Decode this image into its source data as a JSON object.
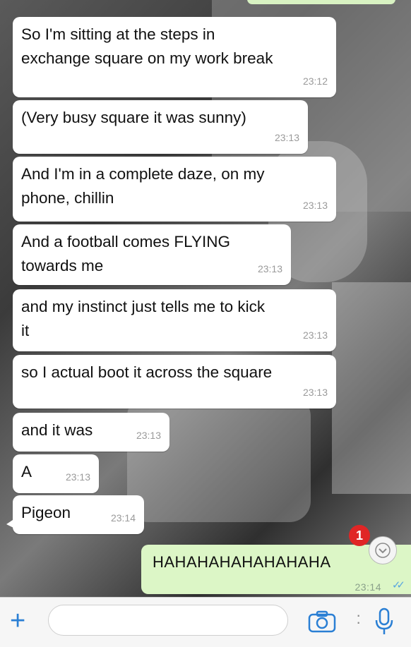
{
  "messages": [
    {
      "text": "So I'm sitting at the steps in\nexchange square on my work break",
      "time": "23:12"
    },
    {
      "text": "(Very busy square it was sunny)",
      "time": "23:13"
    },
    {
      "text": "And I'm in a complete daze, on my\nphone, chillin",
      "time": "23:13"
    },
    {
      "text": "And a football comes FLYING\ntowards me",
      "time": "23:13"
    },
    {
      "text": "and my instinct just tells me to kick\nit",
      "time": "23:13"
    },
    {
      "text": "so I actual boot it across the square",
      "time": "23:13"
    },
    {
      "text": "and it was",
      "time": "23:13"
    },
    {
      "text": "A",
      "time": "23:13"
    },
    {
      "text": "Pigeon",
      "time": "23:14"
    }
  ],
  "outgoing": {
    "text": "HAHAHAHAHAHAHAHA",
    "time": "23:14"
  },
  "unread_count": "1",
  "icons": {
    "plus": "plus-icon",
    "camera": "camera-icon",
    "mic": "microphone-icon",
    "scroll": "chevron-down-icon",
    "ticks": "double-check-icon"
  },
  "colors": {
    "incoming_bubble": "#ffffff",
    "outgoing_bubble": "#dcf6c6",
    "accent": "#2a7fd4",
    "badge": "#e02525",
    "read_ticks": "#5aa7e0"
  }
}
